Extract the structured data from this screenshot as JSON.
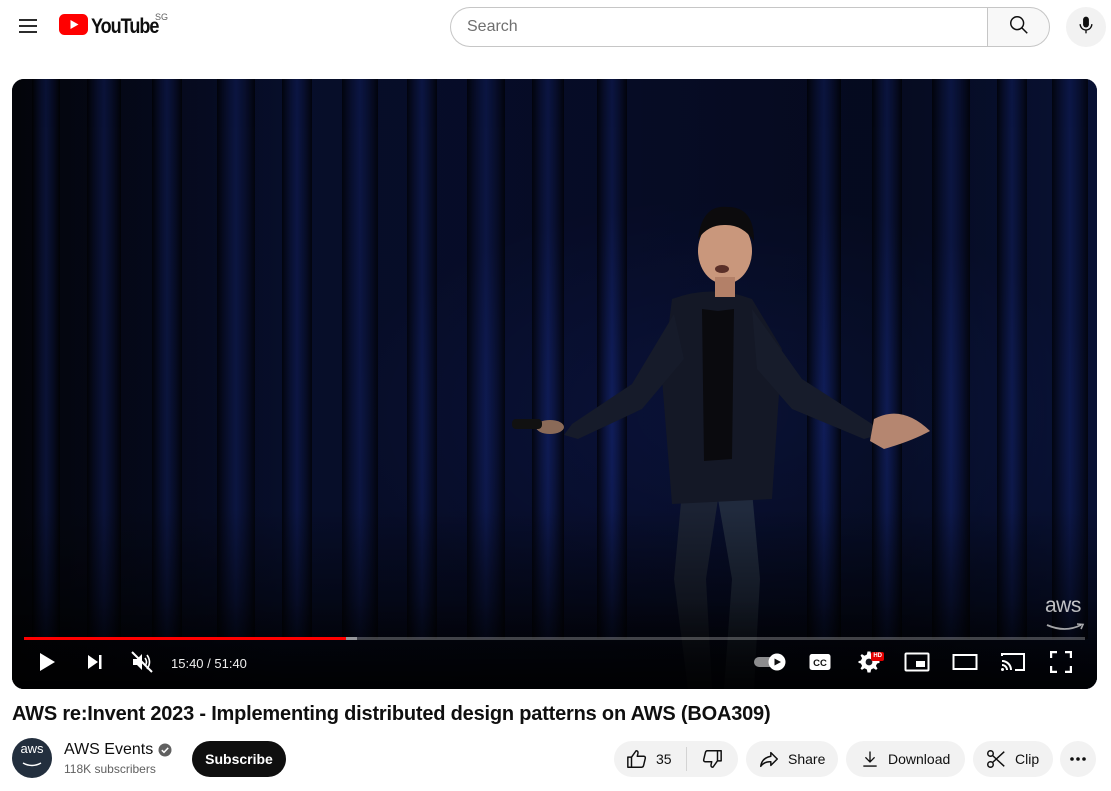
{
  "masthead": {
    "logo_text": "YouTube",
    "region": "SG",
    "search_placeholder": "Search"
  },
  "player": {
    "watermark": "aws",
    "current_time": "15:40",
    "duration": "51:40",
    "time_display": "15:40 / 51:40",
    "progress_fraction": 0.3033,
    "buffered_fraction": 0.3135,
    "hd_badge": "HD",
    "autoplay": "on",
    "muted": true
  },
  "video": {
    "title": "AWS re:Invent 2023 - Implementing distributed design patterns on AWS (BOA309)"
  },
  "channel": {
    "avatar_text": "aws",
    "name": "AWS Events",
    "verified": true,
    "subscribers": "118K subscribers",
    "subscribe_label": "Subscribe"
  },
  "actions": {
    "like_count": "35",
    "share_label": "Share",
    "download_label": "Download",
    "clip_label": "Clip"
  },
  "colors": {
    "brand_red": "#ff0000",
    "dark": "#0f0f0f",
    "pill_bg": "#f2f2f2"
  }
}
